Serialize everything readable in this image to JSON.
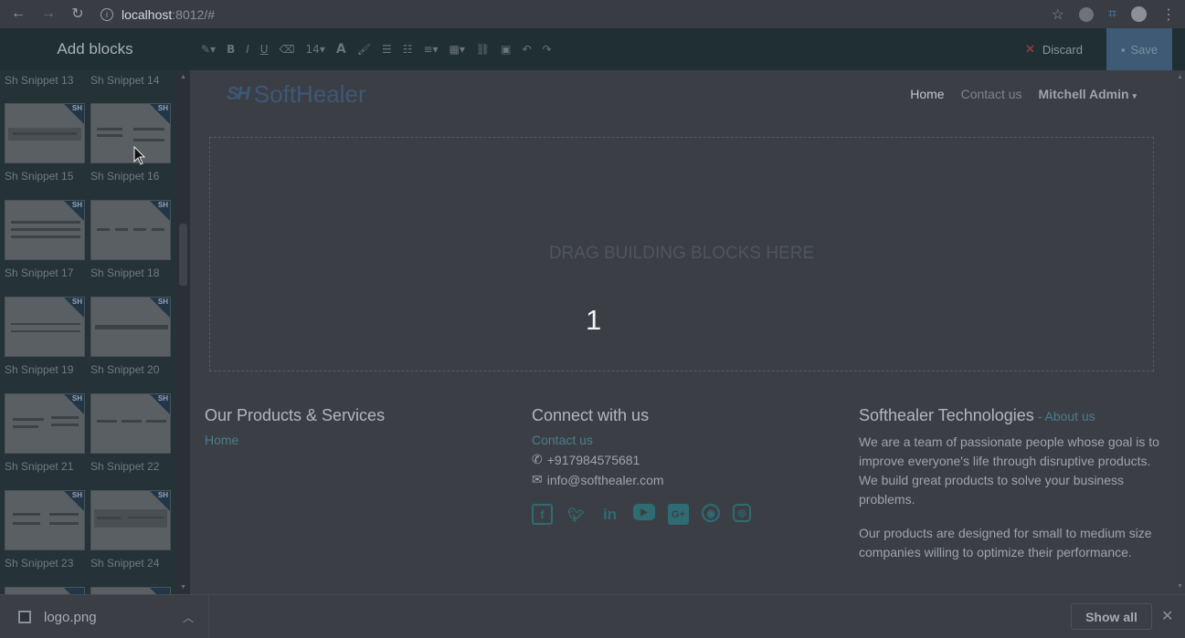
{
  "browser": {
    "url_host": "localhost",
    "url_rest": ":8012/#"
  },
  "editor": {
    "add_blocks": "Add blocks",
    "font_size": "14",
    "discard": "Discard",
    "save": "Save"
  },
  "sidebar": {
    "labels": [
      "Sh Snippet 13",
      "Sh Snippet 14",
      "Sh Snippet 15",
      "Sh Snippet 16",
      "Sh Snippet 17",
      "Sh Snippet 18",
      "Sh Snippet 19",
      "Sh Snippet 20",
      "Sh Snippet 21",
      "Sh Snippet 22",
      "Sh Snippet 23",
      "Sh Snippet 24"
    ],
    "badge": "SH"
  },
  "site": {
    "logo_mark": "SH",
    "logo_text": "SoftHealer",
    "menu": {
      "home": "Home",
      "contact": "Contact us",
      "admin": "Mitchell Admin"
    },
    "dropzone": "DRAG BUILDING BLOCKS HERE",
    "overlay_number": "1",
    "col1": {
      "title": "Our Products & Services",
      "link": "Home"
    },
    "col2": {
      "title": "Connect with us",
      "link": "Contact us",
      "phone": "+917984575681",
      "email": "info@softhealer.com"
    },
    "col3": {
      "title": "Softhealer Technologies",
      "sep": " - ",
      "about": "About us",
      "p1": "We are a team of passionate people whose goal is to improve everyone's life through disruptive products. We build great products to solve your business problems.",
      "p2": "Our products are designed for small to medium size companies willing to optimize their performance."
    },
    "social_icons": [
      "facebook-icon",
      "twitter-icon",
      "linkedin-icon",
      "youtube-icon",
      "google-plus-icon",
      "github-icon",
      "instagram-icon"
    ]
  },
  "downloads": {
    "file": "logo.png",
    "show_all": "Show all"
  }
}
